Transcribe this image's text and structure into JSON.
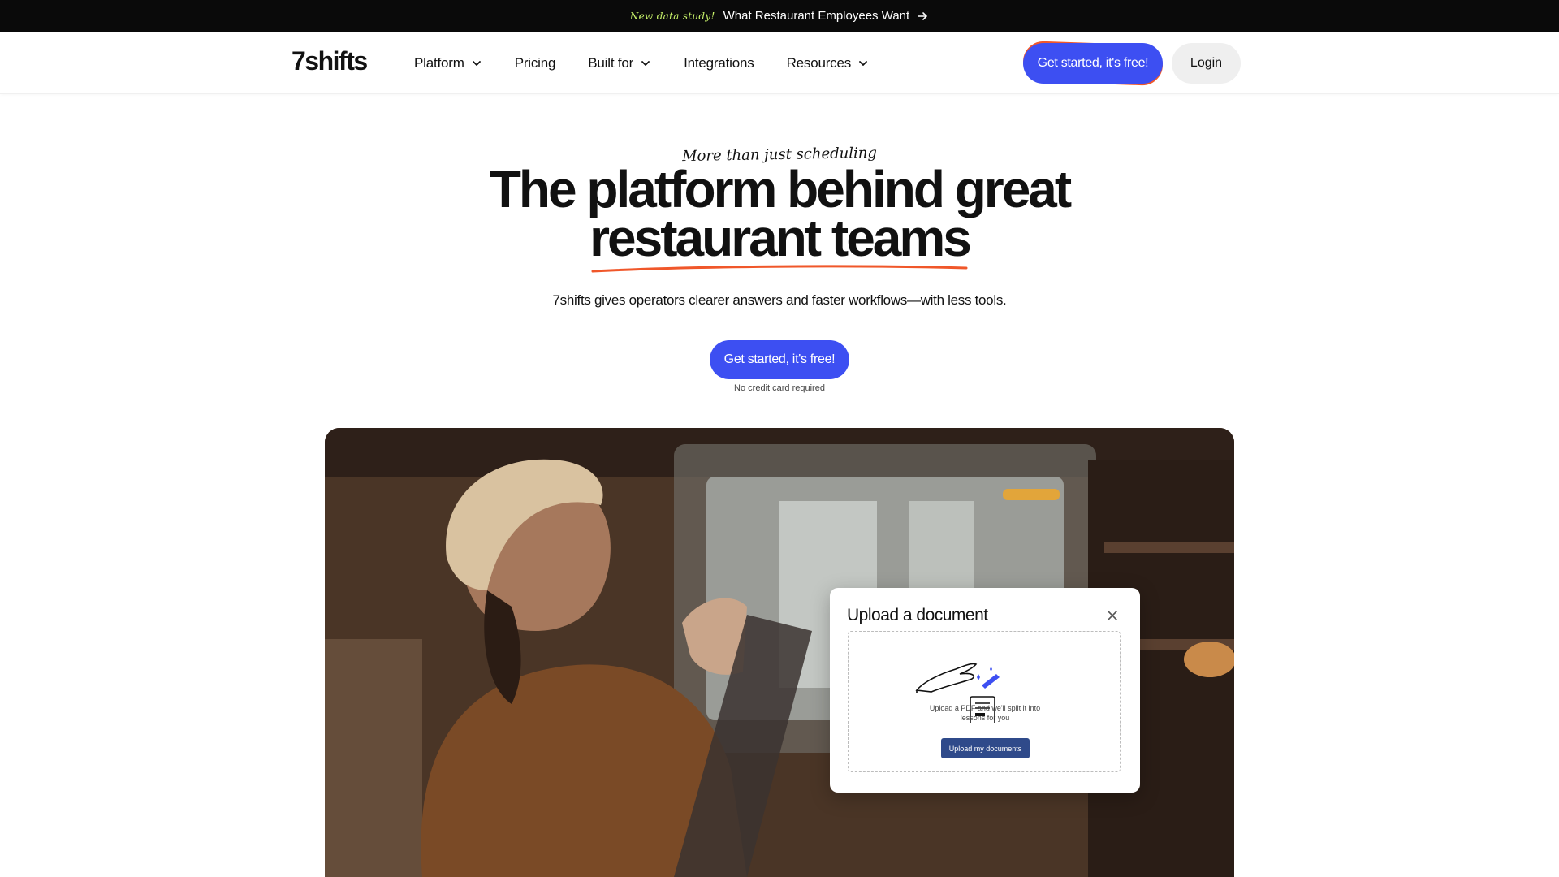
{
  "banner": {
    "tag": "New data study!",
    "message": "What Restaurant Employees Want",
    "arrow_icon": "arrow-right-icon"
  },
  "nav": {
    "logo": "7shifts",
    "items": [
      {
        "label": "Platform",
        "has_dropdown": true
      },
      {
        "label": "Pricing",
        "has_dropdown": false
      },
      {
        "label": "Built for",
        "has_dropdown": true
      },
      {
        "label": "Integrations",
        "has_dropdown": false
      },
      {
        "label": "Resources",
        "has_dropdown": true
      }
    ],
    "cta_label": "Get started, it's free!",
    "login_label": "Login"
  },
  "hero": {
    "eyebrow": "More than just scheduling",
    "headline_line1": "The platform behind great",
    "headline_line2": "restaurant teams",
    "subheadline": "7shifts gives operators clearer answers and faster workflows—with less tools.",
    "cta_label": "Get started, it's free!",
    "cta_note": "No credit card required"
  },
  "modal": {
    "title": "Upload a document",
    "drop_text_line1": "Upload a PDF and we'll split it into",
    "drop_text_line2": "lessons for you",
    "upload_button": "Upload my documents"
  },
  "colors": {
    "accent": "#3d4ff2",
    "underline": "#f0572a",
    "banner_bg": "#0a0a0a",
    "banner_tag": "#c8f26a"
  }
}
